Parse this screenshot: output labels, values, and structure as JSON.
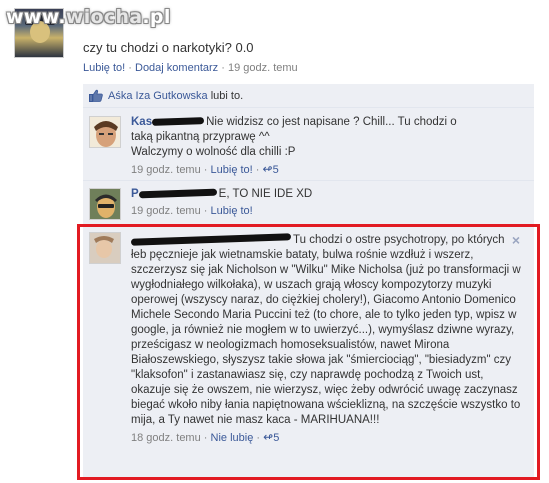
{
  "watermark": {
    "prefix": "www.",
    "name": "wiocha",
    "suffix": ".pl"
  },
  "post": {
    "text": "czy tu chodzi o narkotyki? 0.0",
    "like_label": "Lubię to!",
    "comment_label": "Dodaj komentarz",
    "separator": "·",
    "time": "19 godz. temu"
  },
  "likes": {
    "names": "Aśka Iza Gutkowska",
    "suffix": "lubi to."
  },
  "comments": [
    {
      "name_visible": "Kas",
      "text_line1": "Nie widzisz co jest napisane ? Chill... Tu chodzi o",
      "text_rest": "taką pikantną przyprawę ^^\nWalczymy o wolność dla chilli :P",
      "time": "19 godz. temu",
      "like_label": "Lubię to!",
      "likes_count": "5"
    },
    {
      "name_visible": "P",
      "text_line1": "E, TO NIE IDE XD",
      "time": "19 godz. temu",
      "like_label": "Lubię to!"
    },
    {
      "name_visible": "",
      "text_line1": "Tu chodzi o ostre psychotropy, po",
      "text_rest": "których łeb pęcznieje jak wietnamskie bataty, bulwa rośnie wzdłuż i wszerz, szczerzysz się jak Nicholson w \"Wilku\" Mike Nicholsa (już po transformacji w wygłodniałego wilkołaka), w uszach grają włoscy kompozytorzy muzyki operowej (wszyscy naraz, do ciężkiej cholery!), Giacomo Antonio Domenico Michele Secondo Maria Puccini też (to chore, ale to tylko jeden typ, wpisz w google, ja również nie mogłem w to uwierzyć...), wymyślasz dziwne wyrazy, prześcigasz w neologizmach homoseksualistów, nawet Mirona Białoszewskiego, słyszysz takie słowa jak \"śmierciociąg\", \"biesiadyzm\" czy \"klaksofon\" i zastanawiasz się, czy naprawdę pochodzą z Twoich ust, okazuje się że owszem, nie wierzysz, więc żeby odwrócić uwagę zaczynasz biegać wkoło niby łania napiętnowana wścieklizną, na szczęście wszystko to mija, a Ty nawet nie masz kaca - MARIHUANA!!!",
      "time": "18 godz. temu",
      "like_label": "Nie lubię",
      "likes_count": "5",
      "close": "×"
    }
  ],
  "colors": {
    "link": "#3b5998",
    "highlight": "#e21b22",
    "thread_bg": "#edeff4"
  },
  "icons": [
    "thumbs-up-icon",
    "close-icon",
    "like-count-icon"
  ]
}
